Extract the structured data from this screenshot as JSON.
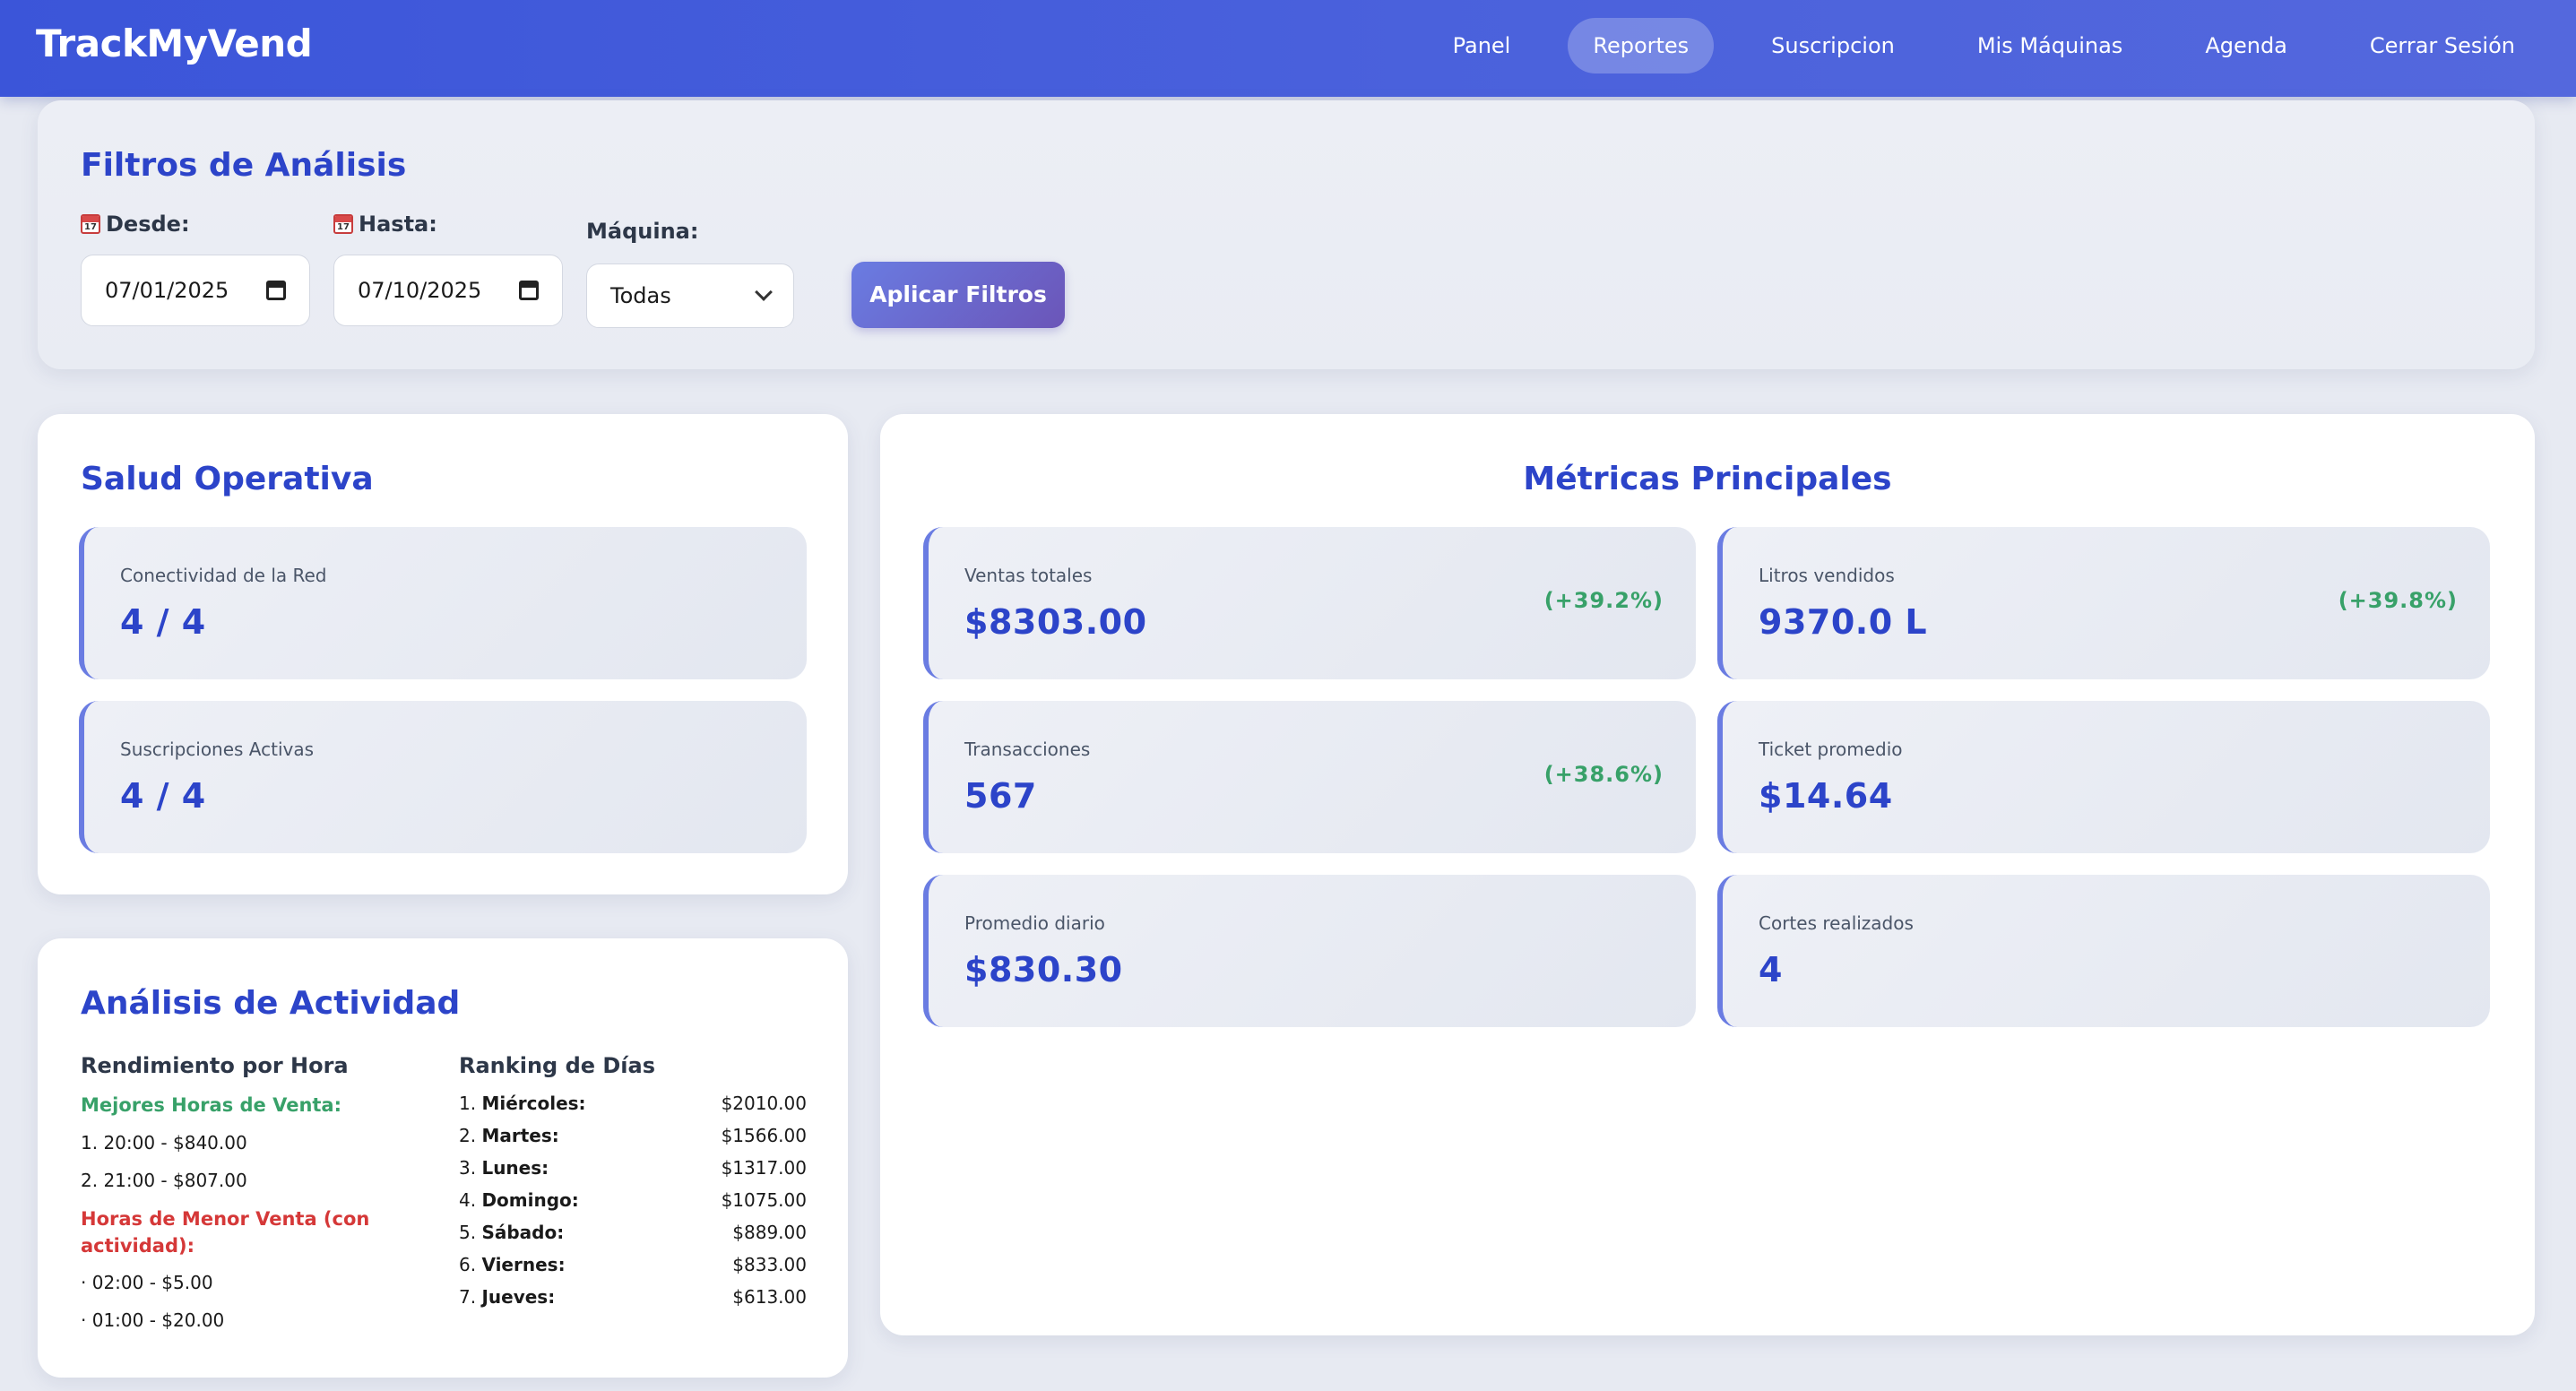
{
  "app": {
    "brand": "TrackMyVend"
  },
  "nav": {
    "items": [
      {
        "label": "Panel"
      },
      {
        "label": "Reportes"
      },
      {
        "label": "Suscripcion"
      },
      {
        "label": "Mis Máquinas"
      },
      {
        "label": "Agenda"
      },
      {
        "label": "Cerrar Sesión"
      }
    ],
    "active": "Reportes"
  },
  "filters": {
    "title": "Filtros de Análisis",
    "desde_label": "Desde:",
    "desde_value": "07/01/2025",
    "hasta_label": "Hasta:",
    "hasta_value": "07/10/2025",
    "maquina_label": "Máquina:",
    "maquina_value": "Todas",
    "apply_label": "Aplicar Filtros"
  },
  "salud": {
    "title": "Salud Operativa",
    "items": [
      {
        "label": "Conectividad de la Red",
        "value": "4 / 4"
      },
      {
        "label": "Suscripciones Activas",
        "value": "4 / 4"
      }
    ]
  },
  "metricas": {
    "title": "Métricas Principales",
    "items": [
      {
        "label": "Ventas totales",
        "value": "$8303.00",
        "change": "(+39.2%)"
      },
      {
        "label": "Litros vendidos",
        "value": "9370.0 L",
        "change": "(+39.8%)"
      },
      {
        "label": "Transacciones",
        "value": "567",
        "change": "(+38.6%)"
      },
      {
        "label": "Ticket promedio",
        "value": "$14.64",
        "change": ""
      },
      {
        "label": "Promedio diario",
        "value": "$830.30",
        "change": ""
      },
      {
        "label": "Cortes realizados",
        "value": "4",
        "change": ""
      }
    ]
  },
  "actividad": {
    "title": "Análisis de Actividad",
    "hora_title": "Rendimiento por Hora",
    "mejores_label": "Mejores Horas de Venta:",
    "mejores": [
      "1. 20:00 - $840.00",
      "2. 21:00 - $807.00"
    ],
    "menor_label": "Horas de Menor Venta (con actividad):",
    "menor": [
      "· 02:00 - $5.00",
      "· 01:00 - $20.00"
    ],
    "ranking_title": "Ranking de Días",
    "ranking": [
      {
        "pos": "1.",
        "day": "Miércoles:",
        "value": "$2010.00"
      },
      {
        "pos": "2.",
        "day": "Martes:",
        "value": "$1566.00"
      },
      {
        "pos": "3.",
        "day": "Lunes:",
        "value": "$1317.00"
      },
      {
        "pos": "4.",
        "day": "Domingo:",
        "value": "$1075.00"
      },
      {
        "pos": "5.",
        "day": "Sábado:",
        "value": "$889.00"
      },
      {
        "pos": "6.",
        "day": "Viernes:",
        "value": "$833.00"
      },
      {
        "pos": "7.",
        "day": "Jueves:",
        "value": "$613.00"
      }
    ]
  },
  "colors": {
    "accent": "#2c44c9",
    "nav_bg": "#3b55d9",
    "positive": "#38a169",
    "negative": "#d53838"
  }
}
